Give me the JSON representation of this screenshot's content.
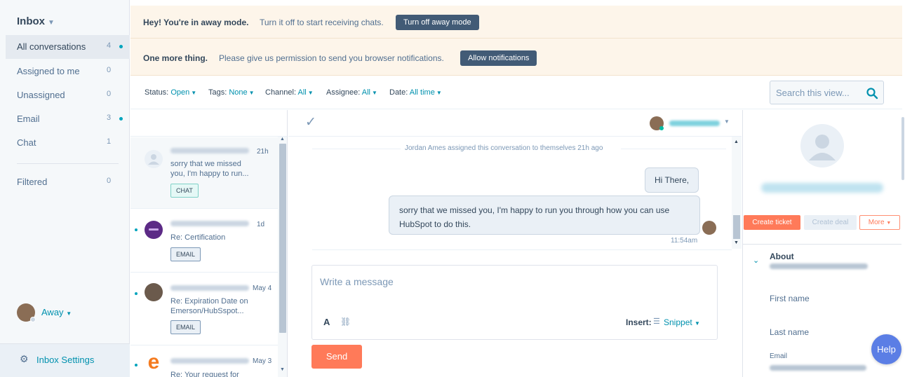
{
  "colors": {
    "accent": "#0091ae",
    "primary_button": "#ff7a59",
    "banner_button": "#425b76",
    "unread_dot": "#00a4bd",
    "banner_bg": "#fdf5ea",
    "help_button": "#5b7ee5"
  },
  "sidebar": {
    "title": "Inbox",
    "items": [
      {
        "label": "All conversations",
        "count": "4",
        "unread": true,
        "active": true
      },
      {
        "label": "Assigned to me",
        "count": "0",
        "unread": false
      },
      {
        "label": "Unassigned",
        "count": "0",
        "unread": false
      },
      {
        "label": "Email",
        "count": "3",
        "unread": true
      },
      {
        "label": "Chat",
        "count": "1",
        "unread": false
      }
    ],
    "filtered": {
      "label": "Filtered",
      "count": "0"
    },
    "status_label": "Away",
    "settings_label": "Inbox Settings"
  },
  "banners": {
    "away": {
      "strong": "Hey! You're in away mode.",
      "text": "Turn it off to start receiving chats.",
      "button": "Turn off away mode"
    },
    "notify": {
      "strong": "One more thing.",
      "text": "Please give us permission to send you browser notifications.",
      "button": "Allow notifications"
    }
  },
  "filters": [
    {
      "label": "Status:",
      "value": "Open"
    },
    {
      "label": "Tags:",
      "value": "None"
    },
    {
      "label": "Channel:",
      "value": "All"
    },
    {
      "label": "Assignee:",
      "value": "All"
    },
    {
      "label": "Date:",
      "value": "All time"
    }
  ],
  "search": {
    "placeholder": "Search this view..."
  },
  "conversations": [
    {
      "time": "21h",
      "preview": "sorry that we missed you, I'm happy to run...",
      "tag": "CHAT",
      "unread": false
    },
    {
      "time": "1d",
      "preview": "Re: Certification",
      "tag": "EMAIL",
      "unread": true
    },
    {
      "time": "May 4",
      "preview": "Re: Expiration Date on Emerson/HubSspot...",
      "tag": "EMAIL",
      "unread": true
    },
    {
      "time": "May 3",
      "preview": "Re: Your request for",
      "tag": "",
      "unread": true
    }
  ],
  "thread": {
    "system_message": "Jordan Ames assigned this conversation to themselves 21h ago",
    "messages": [
      {
        "text": "Hi There,"
      },
      {
        "text": "sorry that we missed you, I'm happy to run you through how you can use HubSpot to do this.",
        "time": "11:54am"
      }
    ],
    "composer": {
      "placeholder": "Write a message",
      "font_icon_label": "A",
      "insert_label": "Insert:",
      "snippet_label": "Snippet"
    },
    "send_label": "Send"
  },
  "contact": {
    "buttons": {
      "ticket": "Create ticket",
      "deal": "Create deal",
      "more": "More"
    },
    "about_label": "About",
    "fields": {
      "first_name": "First name",
      "last_name": "Last name",
      "email": "Email"
    }
  },
  "help_label": "Help"
}
